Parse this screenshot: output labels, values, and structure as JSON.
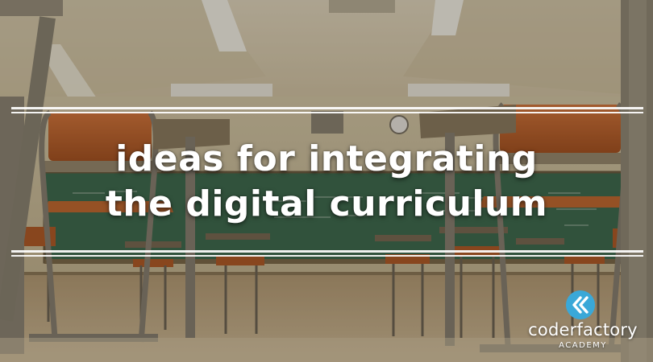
{
  "headline": {
    "line1": "ideas for integrating",
    "line2": "the digital curriculum"
  },
  "logo": {
    "wordmark": "coderfactory",
    "subtitle": "ACADEMY",
    "icon": "chevron-double-left-icon",
    "icon_color": "#3aa8d8"
  },
  "colors": {
    "text": "#ffffff",
    "rule": "#ffffff",
    "chair_seat": "#c9662a",
    "chalkboard": "#3c6b4e"
  }
}
